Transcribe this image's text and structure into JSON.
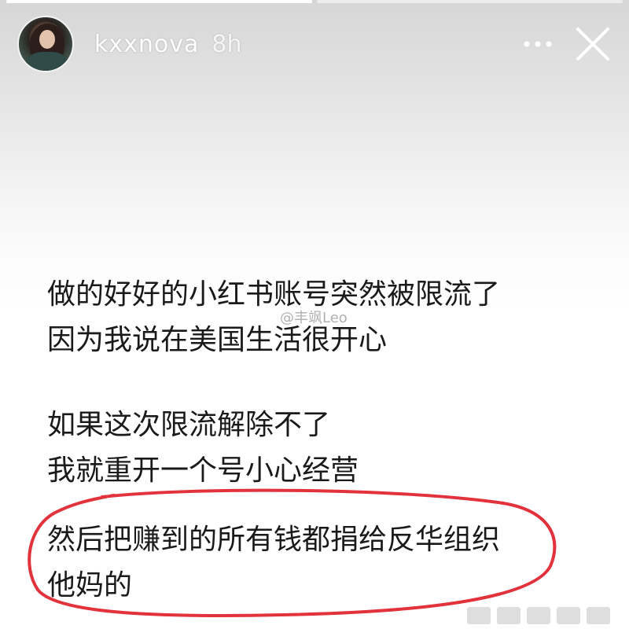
{
  "story": {
    "progress": [
      1.0,
      0.0
    ],
    "header": {
      "username": "kxxnova",
      "time": "8h"
    },
    "text_block_1": [
      "做的好好的小红书账号突然被限流了",
      "因为我说在美国生活很开心"
    ],
    "text_block_2": [
      "如果这次限流解除不了",
      "我就重开一个号小心经营"
    ],
    "text_block_3": [
      "然后把赚到的所有钱都捐给反华组织",
      "他妈的"
    ],
    "watermark": "@丰飒Leo",
    "highlight_color": "#e2323c",
    "icons": {
      "more": "more-dots-icon",
      "close": "close-icon"
    }
  }
}
